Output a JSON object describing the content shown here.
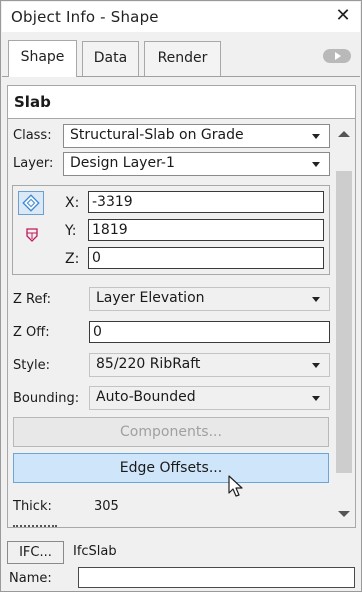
{
  "window": {
    "title": "Object Info - Shape"
  },
  "tabs": [
    {
      "label": "Shape",
      "active": true
    },
    {
      "label": "Data",
      "active": false
    },
    {
      "label": "Render",
      "active": false
    }
  ],
  "header": {
    "object_type": "Slab"
  },
  "fields": {
    "class": {
      "label": "Class:",
      "value": "Structural-Slab on Grade"
    },
    "layer": {
      "label": "Layer:",
      "value": "Design Layer-1"
    },
    "x": {
      "label": "X:",
      "value": "-3319"
    },
    "y": {
      "label": "Y:",
      "value": "1819"
    },
    "z": {
      "label": "Z:",
      "value": "0"
    },
    "zref": {
      "label": "Z Ref:",
      "value": "Layer Elevation"
    },
    "zoff": {
      "label": "Z Off:",
      "value": "0"
    },
    "style": {
      "label": "Style:",
      "value": "85/220 RibRaft"
    },
    "bounding": {
      "label": "Bounding:",
      "value": "Auto-Bounded"
    },
    "thick": {
      "label": "Thick:",
      "value": "305"
    }
  },
  "buttons": {
    "components": "Components...",
    "edge_offsets": "Edge Offsets..."
  },
  "ifc": {
    "button_label": "IFC...",
    "entity": "IfcSlab",
    "name_label": "Name:",
    "name_value": ""
  },
  "colors": {
    "accent_button": "#cfe5fa",
    "accent_border": "#6aa6dc",
    "icon_pink": "#c2185b"
  }
}
